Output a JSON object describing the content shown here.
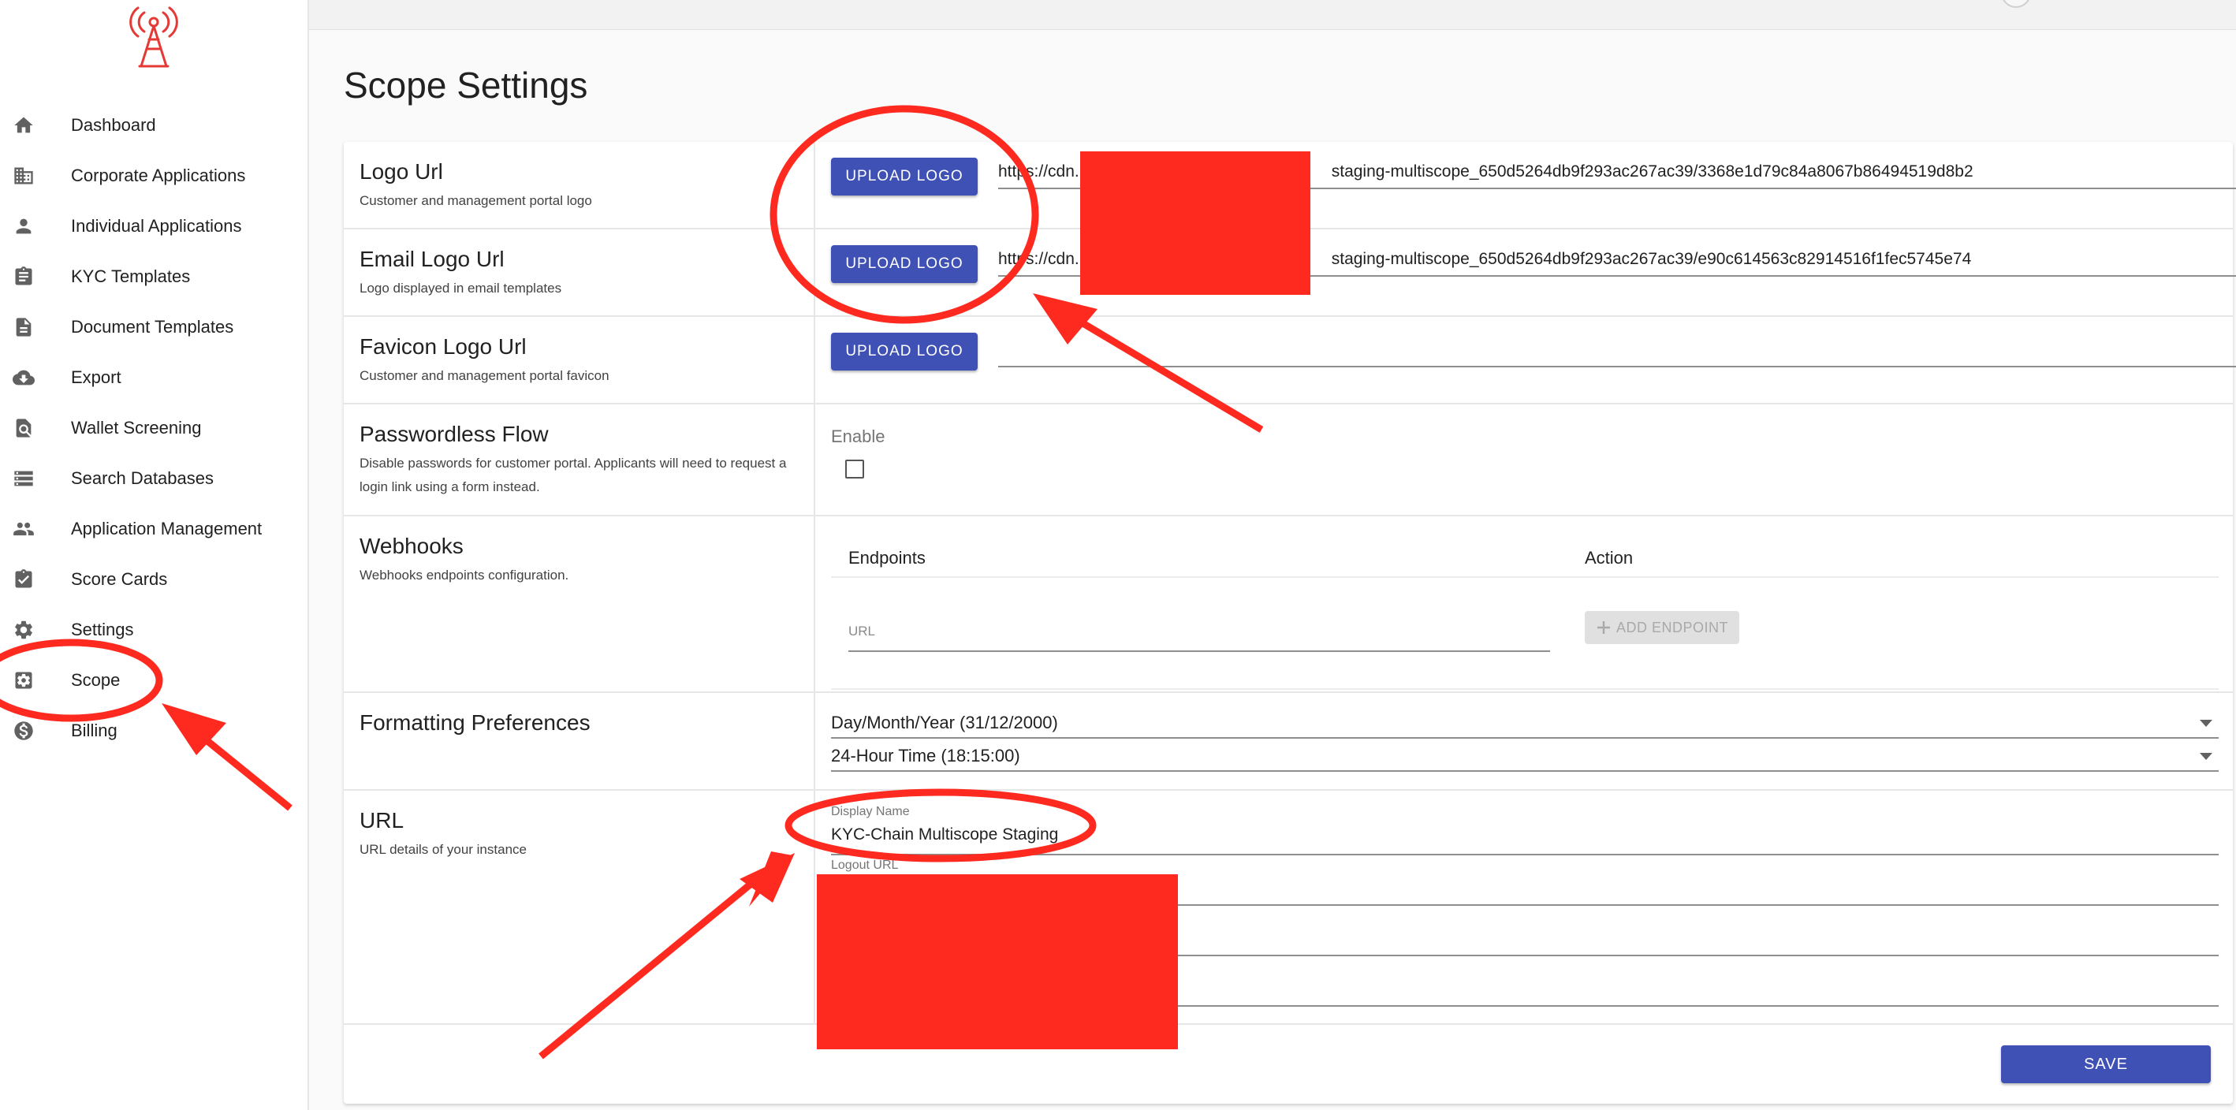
{
  "sidebar": {
    "logo_icon": "radio-tower-icon",
    "items": [
      {
        "label": "Dashboard",
        "icon": "home-icon"
      },
      {
        "label": "Corporate Applications",
        "icon": "building-icon"
      },
      {
        "label": "Individual Applications",
        "icon": "person-icon"
      },
      {
        "label": "KYC Templates",
        "icon": "clipboard-icon"
      },
      {
        "label": "Document Templates",
        "icon": "document-icon"
      },
      {
        "label": "Export",
        "icon": "cloud-download-icon"
      },
      {
        "label": "Wallet Screening",
        "icon": "search-document-icon"
      },
      {
        "label": "Search Databases",
        "icon": "list-icon"
      },
      {
        "label": "Application Management",
        "icon": "people-icon"
      },
      {
        "label": "Score Cards",
        "icon": "clipboard-check-icon"
      },
      {
        "label": "Settings",
        "icon": "gear-icon"
      },
      {
        "label": "Scope",
        "icon": "settings-box-icon"
      },
      {
        "label": "Billing",
        "icon": "dollar-circle-icon"
      }
    ]
  },
  "page": {
    "title": "Scope Settings"
  },
  "logo_url": {
    "title": "Logo Url",
    "description": "Customer and management portal logo",
    "button": "UPLOAD LOGO",
    "value_start": "https://cdn.",
    "value_end": "staging-multiscope_650d5264db9f293ac267ac39/3368e1d79c84a8067b86494519d8b2"
  },
  "email_logo_url": {
    "title": "Email Logo Url",
    "description": "Logo displayed in email templates",
    "button": "UPLOAD LOGO",
    "value_start": "https://cdn.",
    "value_end": "staging-multiscope_650d5264db9f293ac267ac39/e90c614563c82914516f1fec5745e74"
  },
  "favicon_logo_url": {
    "title": "Favicon Logo Url",
    "description": "Customer and management portal favicon",
    "button": "UPLOAD LOGO",
    "value": ""
  },
  "passwordless": {
    "title": "Passwordless Flow",
    "description_line1": "Disable passwords for customer portal. Applicants will need to request a",
    "description_line2": "login link using a form instead.",
    "enable_label": "Enable"
  },
  "webhooks": {
    "title": "Webhooks",
    "description": "Webhooks endpoints configuration.",
    "col_endpoints": "Endpoints",
    "col_action": "Action",
    "url_placeholder": "URL",
    "add_button": "ADD ENDPOINT"
  },
  "formatting": {
    "title": "Formatting Preferences",
    "date_format": "Day/Month/Year (31/12/2000)",
    "time_format": "24-Hour Time (18:15:00)"
  },
  "url_section": {
    "title": "URL",
    "description": "URL details of your instance",
    "display_name_label": "Display Name",
    "display_name_value": "KYC-Chain Multiscope Staging",
    "logout_label": "Logout URL"
  },
  "actions": {
    "save": "SAVE"
  },
  "annotation_color": "#ff2a1f",
  "brand_color": "#3f51b5"
}
